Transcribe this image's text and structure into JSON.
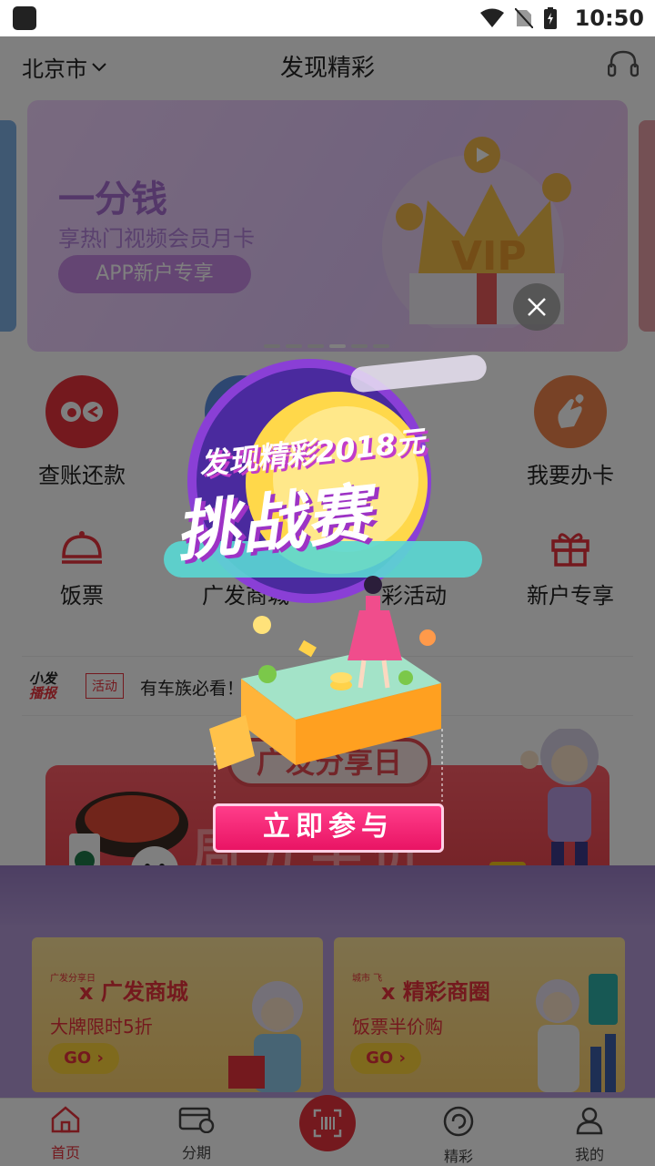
{
  "status_bar": {
    "time": "10:50"
  },
  "header": {
    "city": "北京市",
    "title": "发现精彩"
  },
  "banner": {
    "title": "一分钱",
    "subtitle": "享热门视频会员月卡",
    "pill": "APP新户专享",
    "vip_text": "VIP"
  },
  "quick_row1": [
    {
      "label": "查账还款",
      "icon": "eyes-icon"
    },
    {
      "label": "",
      "icon": "cloud-icon"
    },
    {
      "label": "",
      "icon": "hidden"
    },
    {
      "label": "",
      "icon": "hidden"
    },
    {
      "label": "我要办卡",
      "icon": "finger-heart-icon"
    }
  ],
  "quick_row2": [
    {
      "label": "饭票",
      "icon": "cloche-icon"
    },
    {
      "label": "广发商城",
      "icon": "shop-icon"
    },
    {
      "label": "彩活动",
      "icon": "activity-icon"
    },
    {
      "label": "新户专享",
      "icon": "gift-icon"
    }
  ],
  "ticker": {
    "brand_line1": "小发",
    "brand_line2": "播报",
    "tag": "活动",
    "text": "有车族必看！每"
  },
  "promo": {
    "cap_text": "广发分享日",
    "stage_text": "周五半价"
  },
  "cards": [
    {
      "badge": "广发分享日",
      "title": "x 广发商城",
      "subtitle": "大牌限时5折",
      "go": "GO ›"
    },
    {
      "badge": "城市 飞",
      "title": "x 精彩商圈",
      "subtitle": "饭票半价购",
      "go": "GO ›"
    }
  ],
  "popup": {
    "line1": "发现精彩2018元",
    "line2": "挑战赛",
    "button": "立即参与"
  },
  "nav": [
    {
      "label": "首页",
      "active": true
    },
    {
      "label": "分期",
      "active": false
    },
    {
      "label": "精彩",
      "active": false
    },
    {
      "label": "我的",
      "active": false
    }
  ],
  "colors": {
    "brand": "#e8333c",
    "popup_button": "#e91464"
  }
}
